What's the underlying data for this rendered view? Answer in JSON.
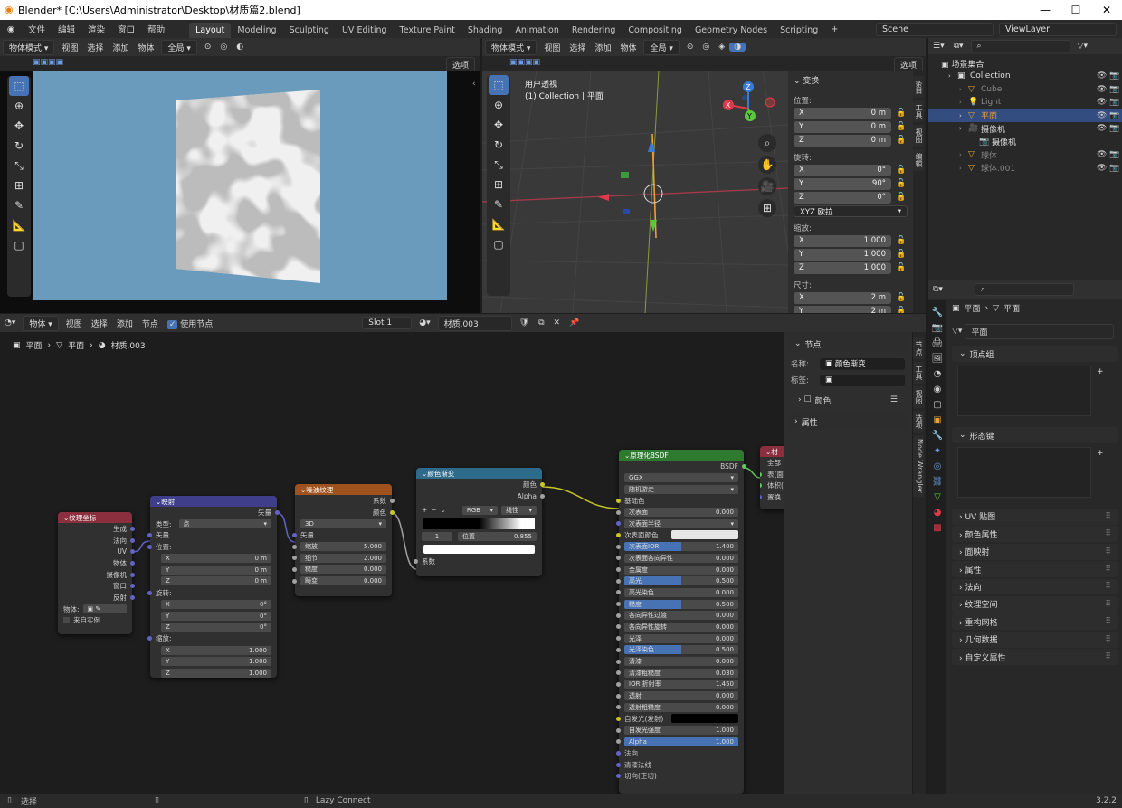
{
  "window": {
    "title": "Blender* [C:\\Users\\Administrator\\Desktop\\材质篇2.blend]",
    "version": "3.2.2"
  },
  "menu": [
    "文件",
    "编辑",
    "渲染",
    "窗口",
    "帮助"
  ],
  "workspaces": [
    "Layout",
    "Modeling",
    "Sculpting",
    "UV Editing",
    "Texture Paint",
    "Shading",
    "Animation",
    "Rendering",
    "Compositing",
    "Geometry Nodes",
    "Scripting"
  ],
  "scene": {
    "name": "Scene",
    "view_layer": "ViewLayer"
  },
  "left_viewport": {
    "mode": "物体模式",
    "menus": [
      "视图",
      "选择",
      "添加",
      "物体"
    ],
    "orient": "全局",
    "options": "选项"
  },
  "right_viewport": {
    "mode": "物体模式",
    "menus": [
      "视图",
      "选择",
      "添加",
      "物体"
    ],
    "orient": "全局",
    "options": "选项",
    "view_name": "用户透视",
    "collection_info": "(1) Collection | 平面"
  },
  "transform": {
    "title": "变换",
    "location_label": "位置:",
    "rotation_label": "旋转:",
    "scale_label": "缩放:",
    "dims_label": "尺寸:",
    "location": [
      {
        "a": "X",
        "v": "0 m"
      },
      {
        "a": "Y",
        "v": "0 m"
      },
      {
        "a": "Z",
        "v": "0 m"
      }
    ],
    "rotation": [
      {
        "a": "X",
        "v": "0°"
      },
      {
        "a": "Y",
        "v": "90°"
      },
      {
        "a": "Z",
        "v": "0°"
      }
    ],
    "rot_mode": "XYZ 欧拉",
    "scale": [
      {
        "a": "X",
        "v": "1.000"
      },
      {
        "a": "Y",
        "v": "1.000"
      },
      {
        "a": "Z",
        "v": "1.000"
      }
    ],
    "dims": [
      {
        "a": "X",
        "v": "2 m"
      },
      {
        "a": "Y",
        "v": "2 m"
      }
    ]
  },
  "viewport_tabs": [
    "条目",
    "工具",
    "视图",
    "编辑"
  ],
  "outliner": {
    "root": "场景集合",
    "items": [
      {
        "name": "Collection",
        "indent": 0,
        "type": "coll"
      },
      {
        "name": "Cube",
        "indent": 1,
        "type": "mesh",
        "dim": true
      },
      {
        "name": "Light",
        "indent": 1,
        "type": "light",
        "dim": true
      },
      {
        "name": "平面",
        "indent": 1,
        "type": "mesh",
        "selected": true
      },
      {
        "name": "摄像机",
        "indent": 1,
        "type": "cam"
      },
      {
        "name": "摄像机",
        "indent": 2,
        "type": "camdata"
      },
      {
        "name": "球体",
        "indent": 1,
        "type": "mesh",
        "dim": true
      },
      {
        "name": "球体.001",
        "indent": 1,
        "type": "mesh",
        "dim": true
      }
    ]
  },
  "node_editor": {
    "type": "物体",
    "menus": [
      "视图",
      "选择",
      "添加",
      "节点"
    ],
    "use_nodes": "使用节点",
    "slot": "Slot 1",
    "material": "材质.003",
    "breadcrumb": [
      "平面",
      "平面",
      "材质.003"
    ],
    "side_tabs": [
      "节点",
      "工具",
      "视图",
      "选项",
      "Node Wrangler"
    ],
    "panel": {
      "title": "节点",
      "name_label": "名称:",
      "name_val": "颜色渐变",
      "label_label": "标签:",
      "color": "颜色",
      "props": "属性"
    }
  },
  "nodes": {
    "texcoord": {
      "title": "纹理坐标",
      "outputs": [
        "生成",
        "法向",
        "UV",
        "物体",
        "摄像机",
        "窗口",
        "反射"
      ],
      "object_label": "物体:",
      "from_inst": "来自实例"
    },
    "mapping": {
      "title": "映射",
      "out": "矢量",
      "type_label": "类型:",
      "type_val": "点",
      "vector": "矢量",
      "loc": "位置:",
      "rot": "旋转:",
      "scl": "缩放:",
      "loc_vals": [
        {
          "a": "X",
          "v": "0 m"
        },
        {
          "a": "Y",
          "v": "0 m"
        },
        {
          "a": "Z",
          "v": "0 m"
        }
      ],
      "rot_vals": [
        {
          "a": "X",
          "v": "0°"
        },
        {
          "a": "Y",
          "v": "0°"
        },
        {
          "a": "Z",
          "v": "0°"
        }
      ],
      "scl_vals": [
        {
          "a": "X",
          "v": "1.000"
        },
        {
          "a": "Y",
          "v": "1.000"
        },
        {
          "a": "Z",
          "v": "1.000"
        }
      ]
    },
    "noise": {
      "title": "噪波纹理",
      "outs": [
        "系数",
        "颜色"
      ],
      "dim": "3D",
      "vector": "矢量",
      "fields": [
        {
          "a": "缩放",
          "v": "5.000"
        },
        {
          "a": "细节",
          "v": "2.000"
        },
        {
          "a": "糙度",
          "v": "0.000"
        },
        {
          "a": "畸变",
          "v": "0.000"
        }
      ]
    },
    "ramp": {
      "title": "颜色渐变",
      "outs": [
        "颜色",
        "Alpha"
      ],
      "mode": "RGB",
      "interp": "线性",
      "index": "1",
      "pos_label": "位置",
      "pos": "0.855",
      "fac": "系数"
    },
    "bsdf": {
      "title": "原理化BSDF",
      "out": "BSDF",
      "dist": "GGX",
      "sss": "随机游走",
      "rows": [
        {
          "t": "sock",
          "a": "基础色",
          "c": "yellow"
        },
        {
          "t": "f",
          "a": "次表面",
          "v": "0.000",
          "c": "gray"
        },
        {
          "t": "dd",
          "a": "次表面半径",
          "c": "purple"
        },
        {
          "t": "col",
          "a": "次表面颜色",
          "c": "yellow",
          "col": "#e6e6e6"
        },
        {
          "t": "fb",
          "a": "次表面IOR",
          "v": "1.400",
          "c": "gray"
        },
        {
          "t": "f",
          "a": "次表面各向异性",
          "v": "0.000",
          "c": "gray"
        },
        {
          "t": "f",
          "a": "金属度",
          "v": "0.000",
          "c": "gray"
        },
        {
          "t": "fb",
          "a": "高光",
          "v": "0.500",
          "c": "gray"
        },
        {
          "t": "f",
          "a": "高光染色",
          "v": "0.000",
          "c": "gray"
        },
        {
          "t": "fb",
          "a": "糙度",
          "v": "0.500",
          "c": "gray"
        },
        {
          "t": "f",
          "a": "各向异性过渡",
          "v": "0.000",
          "c": "gray"
        },
        {
          "t": "f",
          "a": "各向异性旋转",
          "v": "0.000",
          "c": "gray"
        },
        {
          "t": "f",
          "a": "光泽",
          "v": "0.000",
          "c": "gray"
        },
        {
          "t": "fb",
          "a": "光泽染色",
          "v": "0.500",
          "c": "gray"
        },
        {
          "t": "f",
          "a": "清漆",
          "v": "0.000",
          "c": "gray"
        },
        {
          "t": "f",
          "a": "清漆粗糙度",
          "v": "0.030",
          "c": "gray"
        },
        {
          "t": "f",
          "a": "IOR 折射率",
          "v": "1.450",
          "c": "gray"
        },
        {
          "t": "f",
          "a": "透射",
          "v": "0.000",
          "c": "gray"
        },
        {
          "t": "f",
          "a": "透射粗糙度",
          "v": "0.000",
          "c": "gray"
        },
        {
          "t": "col",
          "a": "自发光(发射)",
          "c": "yellow",
          "col": "#000000"
        },
        {
          "t": "f",
          "a": "自发光强度",
          "v": "1.000",
          "c": "gray"
        },
        {
          "t": "ff",
          "a": "Alpha",
          "v": "1.000",
          "c": "gray"
        },
        {
          "t": "sock",
          "a": "法向",
          "c": "purple"
        },
        {
          "t": "sock",
          "a": "清漆法线",
          "c": "purple"
        },
        {
          "t": "sock",
          "a": "切向(正切)",
          "c": "purple"
        }
      ]
    },
    "output": {
      "title": "材",
      "all": "全部",
      "ins": [
        "表(面)",
        "体积(",
        "置换"
      ]
    }
  },
  "properties": {
    "obj": "平面",
    "data": "平面",
    "mesh_name": "平面",
    "vgroups": "顶点组",
    "shapekeys": "形态键",
    "panels": [
      "UV 贴图",
      "颜色属性",
      "面映射",
      "属性",
      "法向",
      "纹理空间",
      "重构网格",
      "几何数据",
      "自定义属性"
    ]
  },
  "status": {
    "left": "选择",
    "mid": "Lazy Connect"
  }
}
